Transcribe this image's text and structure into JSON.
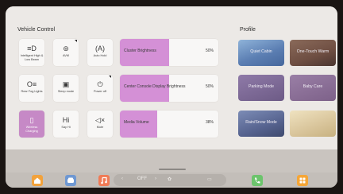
{
  "vehicle_control": {
    "title": "Vehicle Control",
    "tiles": [
      {
        "label": "Intelligent High & Low Beam",
        "icon": "high-low-beam-icon",
        "glyph": "≡D",
        "active": false
      },
      {
        "label": "AVM",
        "icon": "camera-view-icon",
        "glyph": "⊚",
        "active": false
      },
      {
        "label": "Auto Hold",
        "icon": "auto-hold-icon",
        "glyph": "(A)",
        "active": false
      },
      {
        "label": "Rear Fog Lights",
        "icon": "rear-fog-light-icon",
        "glyph": "O≡",
        "active": false
      },
      {
        "label": "Sleep mode",
        "icon": "sleep-mode-icon",
        "glyph": "▣",
        "active": false
      },
      {
        "label": "Power off",
        "icon": "power-icon",
        "glyph": "⏻",
        "active": false
      },
      {
        "label": "Wireless Charging",
        "icon": "wireless-charging-icon",
        "glyph": "▯",
        "active": true
      },
      {
        "label": "Say Hi",
        "icon": "say-hi-icon",
        "glyph": "Hi",
        "active": false
      },
      {
        "label": "Mute",
        "icon": "mute-icon",
        "glyph": "◁×",
        "active": false
      }
    ],
    "sliders": [
      {
        "label": "Cluster Brightness",
        "value_text": "50%",
        "value": 0.5
      },
      {
        "label": "Center Console Display Brightness",
        "value_text": "50%",
        "value": 0.5
      },
      {
        "label": "Media Volume",
        "value_text": "38%",
        "value": 0.38
      }
    ]
  },
  "profile": {
    "title": "Profile",
    "cards": [
      {
        "label": "Quiet Cabin",
        "style": "p-quiet"
      },
      {
        "label": "One-Touch Warm",
        "style": "p-warm"
      },
      {
        "label": "Parking Mode",
        "style": "p-parking"
      },
      {
        "label": "Baby Care",
        "style": "p-baby"
      },
      {
        "label": "Rain/Snow Mode",
        "style": "p-rain"
      },
      {
        "label": "",
        "style": "p-last"
      }
    ]
  },
  "dock": {
    "home_icon": "home-icon",
    "car_icon": "car-icon",
    "music_icon": "music-icon",
    "ac_status": "OFF",
    "fan_icon": "fan-icon",
    "seat_icon": "seat-heat-icon",
    "phone_icon": "phone-icon",
    "apps_icon": "apps-grid-icon",
    "colors": {
      "home": "#f2a23c",
      "car": "#6f98d2",
      "music": "#f07a55",
      "phone": "#6cc46c",
      "apps": "#f5a637"
    }
  }
}
